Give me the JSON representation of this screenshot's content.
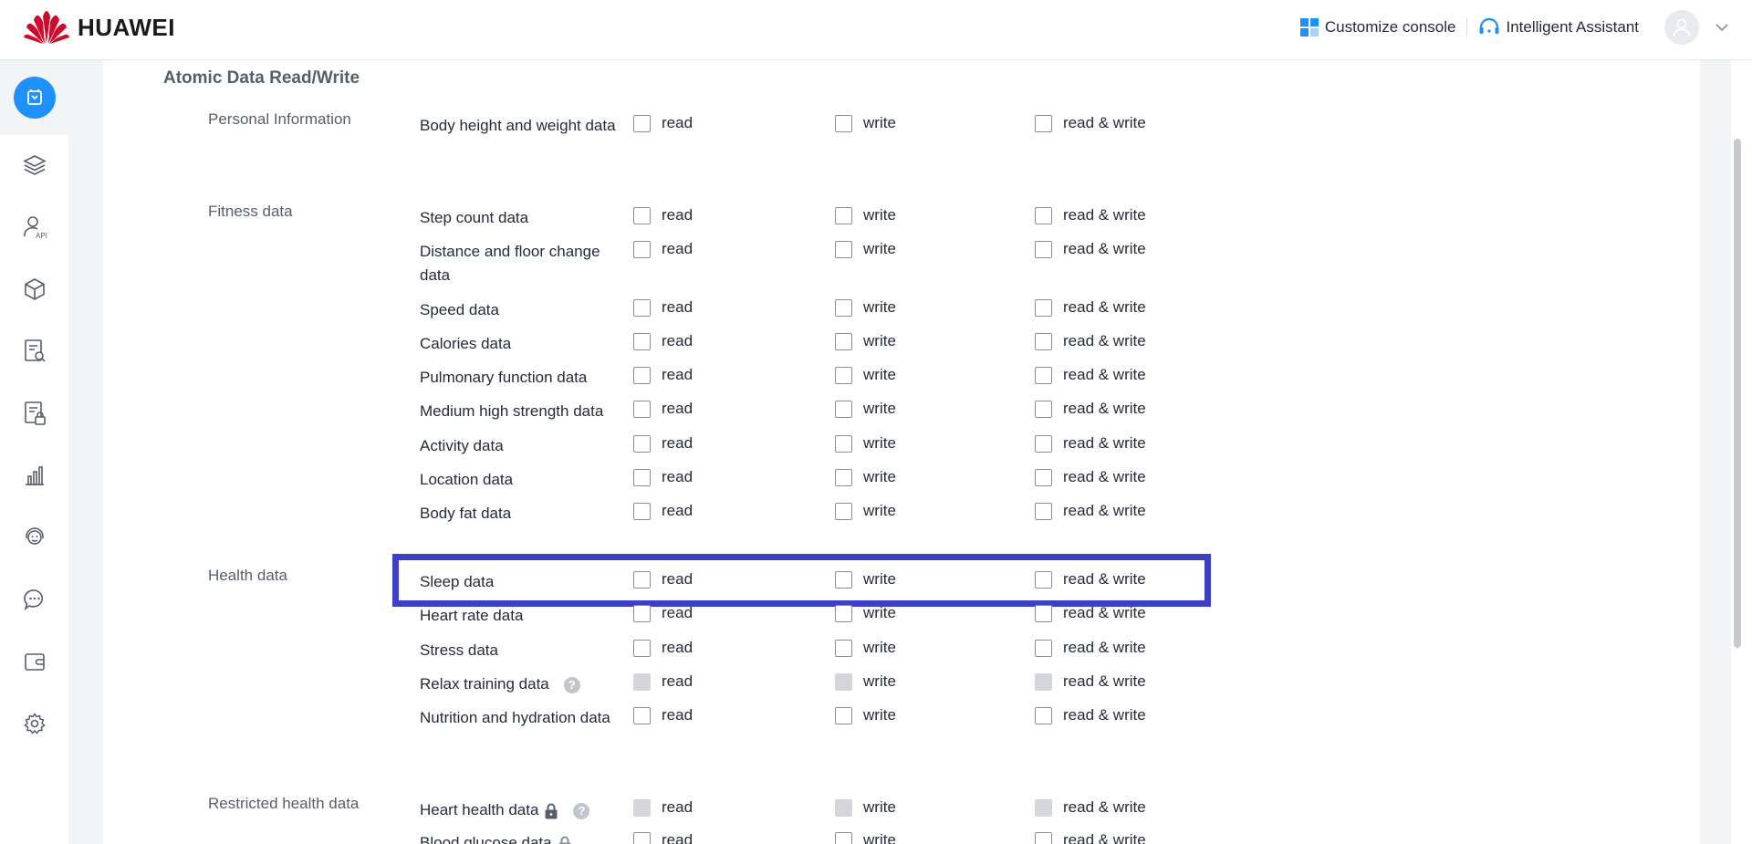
{
  "header": {
    "brand": "HUAWEI",
    "customize_console": "Customize console",
    "intelligent_assistant": "Intelligent Assistant",
    "brand_color": "#cf0a2c",
    "accent_color": "#1e90ff"
  },
  "sidebar": {
    "items": [
      {
        "icon": "app-service-icon",
        "active": true
      },
      {
        "icon": "layers-icon"
      },
      {
        "icon": "user-api-icon"
      },
      {
        "icon": "cube-icon"
      },
      {
        "icon": "document-search-icon"
      },
      {
        "icon": "document-lock-icon"
      },
      {
        "icon": "bar-chart-icon"
      },
      {
        "icon": "support-icon"
      },
      {
        "icon": "chat-icon"
      },
      {
        "icon": "wallet-icon"
      },
      {
        "icon": "settings-icon"
      }
    ]
  },
  "main": {
    "section_title": "Atomic Data Read/Write",
    "option_labels": {
      "read": "read",
      "write": "write",
      "read_write": "read & write"
    },
    "groups": [
      {
        "label": "Personal Information"
      },
      {
        "label": "Fitness data"
      },
      {
        "label": "Health data"
      },
      {
        "label": "Restricted health data"
      }
    ],
    "items": [
      {
        "label": "Body height and weight data"
      },
      {
        "label": "Step count data"
      },
      {
        "label": "Distance and floor change data"
      },
      {
        "label": "Speed data"
      },
      {
        "label": "Calories data"
      },
      {
        "label": "Pulmonary function data"
      },
      {
        "label": "Medium high strength data"
      },
      {
        "label": "Activity data"
      },
      {
        "label": "Location data"
      },
      {
        "label": "Body fat data"
      },
      {
        "label": "Sleep data",
        "highlighted": true
      },
      {
        "label": "Heart rate data"
      },
      {
        "label": "Stress data"
      },
      {
        "label": "Relax training data",
        "help": "?",
        "disabled": true
      },
      {
        "label": "Nutrition and hydration data"
      },
      {
        "label": "Heart health data",
        "help": "?",
        "locked": true,
        "disabled": true
      },
      {
        "label": "Blood glucose data",
        "locked": true
      }
    ],
    "highlight_color": "#3d3fc4"
  }
}
